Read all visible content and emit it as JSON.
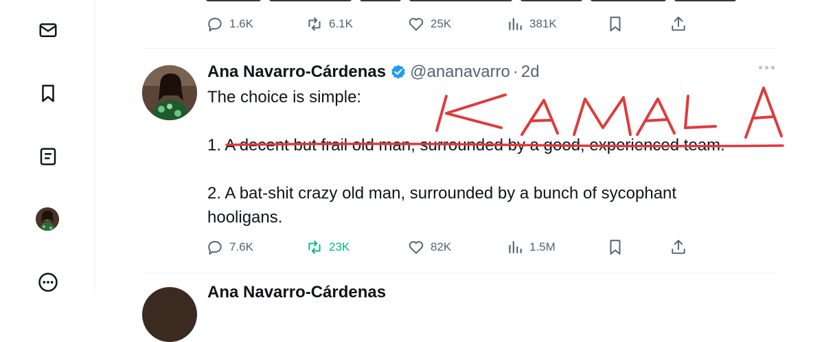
{
  "prev_tweet": {
    "metrics": {
      "replies": "1.6K",
      "reposts": "6.1K",
      "likes": "25K",
      "views": "381K"
    }
  },
  "tweet": {
    "author_name": "Ana Navarro-Cárdenas",
    "handle": "@ananavarro",
    "separator": "·",
    "time": "2d",
    "lines": [
      "The choice is simple:",
      "1. A decent but frail old man, surrounded by a good, experienced team.",
      "2. A bat-shit crazy old man, surrounded by a bunch of sycophant",
      "hooligans."
    ],
    "annotation_text": "KAMALA",
    "metrics": {
      "replies": "7.6K",
      "reposts": "23K",
      "likes": "82K",
      "views": "1.5M"
    }
  },
  "next_tweet": {
    "author_name": "Ana Navarro-Cárdenas"
  },
  "icons": {
    "messages": "envelope-icon",
    "bookmarks": "bookmark-icon",
    "lists": "list-icon",
    "profile": "avatar",
    "more": "more-circle-icon",
    "reply": "reply-icon",
    "repost": "repost-icon",
    "like": "heart-icon",
    "views": "views-icon",
    "bookmark": "bookmark-icon",
    "share": "share-icon"
  },
  "colors": {
    "text": "#0f1419",
    "secondary": "#536471",
    "verified": "#1d9bf0",
    "repost_active": "#00ba7c",
    "annotation": "#e03a3a"
  }
}
